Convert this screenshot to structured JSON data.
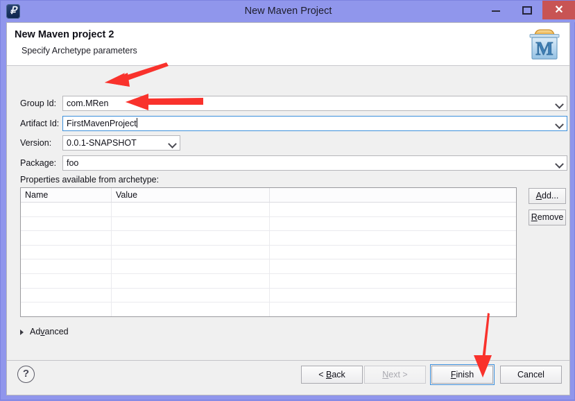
{
  "window": {
    "title": "New Maven Project",
    "app_icon": "eclipse-icon",
    "controls": {
      "minimize": "minimize-icon",
      "maximize": "maximize-icon",
      "close": "✕"
    },
    "close_color": "#c85454",
    "titlebar_color": "#9096ec"
  },
  "header": {
    "title": "New Maven project 2",
    "subtitle": "Specify Archetype parameters",
    "icon": "maven-project-icon"
  },
  "form": {
    "group_id": {
      "label": "Group Id:",
      "value": "com.MRen"
    },
    "artifact_id": {
      "label": "Artifact Id:",
      "value": "FirstMavenProject",
      "focused": true
    },
    "version": {
      "label": "Version:",
      "value": "0.0.1-SNAPSHOT"
    },
    "package": {
      "label": "Package:",
      "value": "foo"
    }
  },
  "properties": {
    "label": "Properties available from archetype:",
    "columns": [
      "Name",
      "Value",
      ""
    ],
    "rows": [
      [
        "",
        "",
        ""
      ],
      [
        "",
        "",
        ""
      ],
      [
        "",
        "",
        ""
      ],
      [
        "",
        "",
        ""
      ],
      [
        "",
        "",
        ""
      ],
      [
        "",
        "",
        ""
      ],
      [
        "",
        "",
        ""
      ],
      [
        "",
        "",
        ""
      ]
    ],
    "buttons": {
      "add": {
        "prefix": "",
        "mnemonic": "A",
        "suffix": "dd..."
      },
      "remove": {
        "prefix": "",
        "mnemonic": "R",
        "suffix": "emove"
      }
    }
  },
  "advanced": {
    "prefix": "Ad",
    "mnemonic": "v",
    "suffix": "anced",
    "expanded": false,
    "triangle": "chevron-right-icon"
  },
  "footer": {
    "help": "?",
    "buttons": [
      {
        "id": "back",
        "prefix": "< ",
        "mnemonic": "B",
        "suffix": "ack",
        "enabled": true,
        "focused": false
      },
      {
        "id": "next",
        "prefix": "",
        "mnemonic": "N",
        "suffix": "ext >",
        "enabled": false,
        "focused": false
      },
      {
        "id": "finish",
        "prefix": "",
        "mnemonic": "F",
        "suffix": "inish",
        "enabled": true,
        "focused": true
      },
      {
        "id": "cancel",
        "prefix": "",
        "mnemonic": "",
        "suffix": "Cancel",
        "enabled": true,
        "focused": false
      }
    ]
  },
  "annotations": {
    "color": "#f9322c",
    "arrows": [
      {
        "name": "arrow-to-group-id",
        "points_at": "group_id field"
      },
      {
        "name": "arrow-to-artifact-id",
        "points_at": "artifact_id field"
      },
      {
        "name": "arrow-to-finish",
        "points_at": "finish button"
      }
    ]
  }
}
